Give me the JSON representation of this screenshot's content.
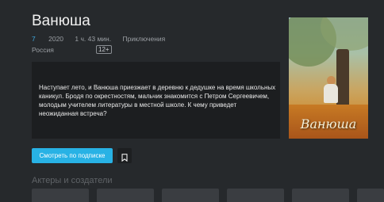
{
  "movie": {
    "title": "Ванюша",
    "rating": "7",
    "year": "2020",
    "duration": "1 ч. 43 мин.",
    "genre": "Приключения",
    "country": "Россия",
    "age_rating": "12+",
    "description": "Наступает лето, и Ванюша приезжает в деревню к дедушке на время школьных каникул. Бродя по окрестностям, мальчик знакомится с Петром Сергеевичем, молодым учителем литературы в местной школе. К чему приведет неожиданная встреча?",
    "poster_title": "Ванюша"
  },
  "actions": {
    "subscribe_label": "Смотреть по подписке",
    "bookmark_icon": "bookmark-icon"
  },
  "cast": {
    "section_title": "Актеры и создатели",
    "cards": [
      "",
      "",
      "",
      "",
      "",
      ""
    ]
  },
  "colors": {
    "background": "#26292c",
    "accent": "#28b2e5",
    "rating": "#3fa9e0"
  }
}
